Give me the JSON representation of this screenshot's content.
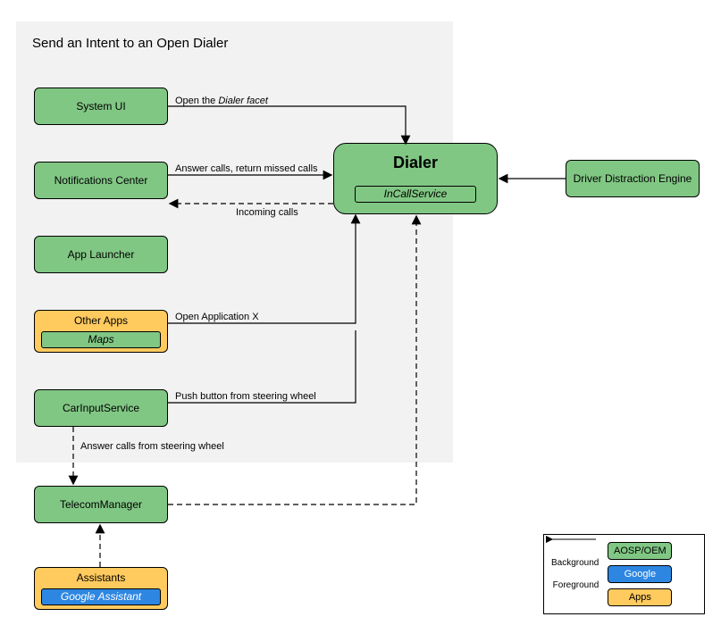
{
  "panel_title": "Send an Intent to an Open Dialer",
  "boxes": {
    "system_ui": "System UI",
    "notifications": "Notifications Center",
    "app_launcher": "App Launcher",
    "other_apps": "Other Apps",
    "maps": "Maps",
    "car_input": "CarInputService",
    "telecom": "TelecomManager",
    "assistants": "Assistants",
    "google_assistant": "Google Assistant",
    "dialer": "Dialer",
    "incall": "InCallService",
    "dde": "Driver Distraction Engine"
  },
  "edges": {
    "open_facet_pre": "Open the ",
    "open_facet_em": "Dialer facet",
    "answer_calls": "Answer calls, return missed calls",
    "incoming": "Incoming calls",
    "open_app_x": "Open Application X",
    "push_button": "Push button from steering wheel",
    "answer_steering": "Answer calls from steering wheel"
  },
  "legend": {
    "background": "Background",
    "foreground": "Foreground",
    "aosp": "AOSP/OEM",
    "google": "Google",
    "apps": "Apps"
  }
}
